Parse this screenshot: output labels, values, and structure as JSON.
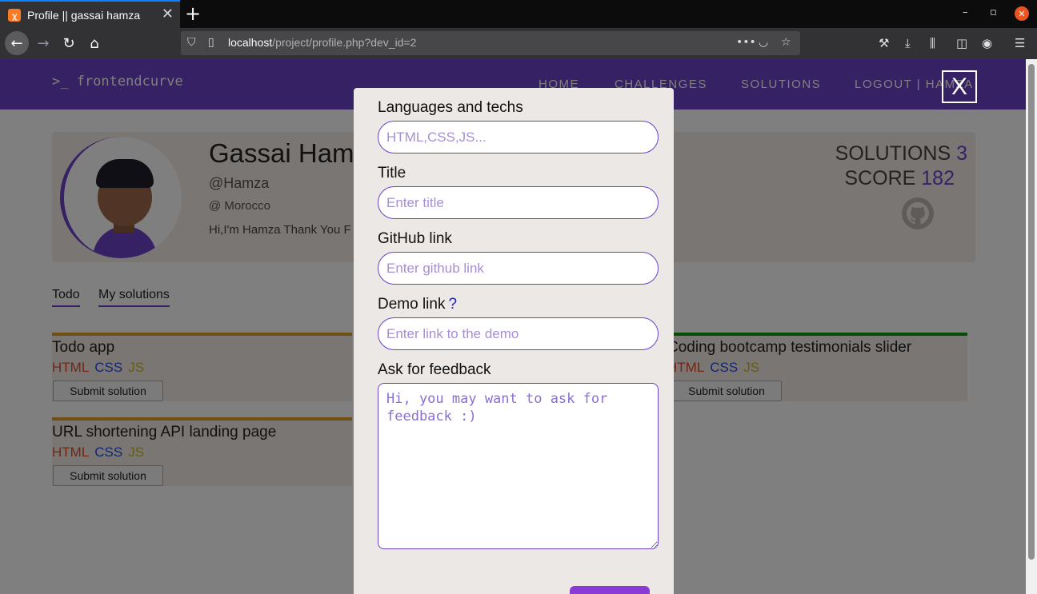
{
  "browser": {
    "tab_title": "Profile || gassai hamza",
    "tab_favicon": "xampp-icon",
    "url_host": "localhost",
    "url_path": "/project/profile.php?dev_id=2"
  },
  "site": {
    "logo": ">_ frontendcurve",
    "menu": [
      "HOME",
      "CHALLENGES",
      "SOLUTIONS",
      "LOGOUT | HAMZA"
    ],
    "accent_color": "#6a43c6"
  },
  "profile": {
    "name": "Gassai Hamza",
    "handle": "@Hamza",
    "location": "Morocco",
    "bio": "Hi,I'm Hamza Thank You F",
    "solutions_label": "SOLUTIONS",
    "solutions_count": "3",
    "score_label": "SCORE",
    "score_value": "182"
  },
  "tabs": [
    "Todo",
    "My solutions"
  ],
  "todos": [
    {
      "title": "Todo app",
      "tags": [
        "HTML",
        "CSS",
        "JS"
      ],
      "button": "Submit solution",
      "bar_color": "#e0a020"
    },
    {
      "title": "URL shortening API landing page",
      "tags": [
        "HTML",
        "CSS",
        "JS"
      ],
      "button": "Submit solution",
      "bar_color": "#e0a020"
    },
    {
      "title": "Coding bootcamp testimonials slider",
      "tags": [
        "HTML",
        "CSS",
        "JS"
      ],
      "button": "Submit solution",
      "bar_color": "#0a9a0a"
    }
  ],
  "modal": {
    "close_label": "X",
    "languages_label": "Languages and techs",
    "languages_placeholder": "HTML,CSS,JS...",
    "title_label": "Title",
    "title_placeholder": "Enter title",
    "github_label": "GitHub link",
    "github_placeholder": "Enter github link",
    "demo_label": "Demo link",
    "demo_help": "?",
    "demo_placeholder": "Enter link to the demo",
    "feedback_label": "Ask for feedback",
    "feedback_placeholder": "Hi, you may want to ask for feedback :)"
  }
}
